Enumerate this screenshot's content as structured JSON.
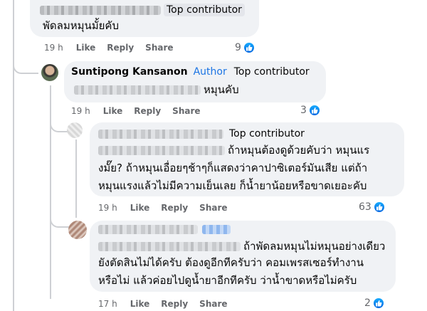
{
  "comments": [
    {
      "author_redacted": true,
      "badge": "Top contributor",
      "text_lines": [
        "พัดลมหมุนมั้ยคับ"
      ],
      "timestamp": "19 h",
      "actions": {
        "like": "Like",
        "reply": "Reply",
        "share": "Share"
      },
      "reaction_count": "9"
    },
    {
      "author": "Suntipong Kansanon",
      "author_label": "Author",
      "badge": "Top contributor",
      "text_suffix": "หมุนคับ",
      "timestamp": "19 h",
      "actions": {
        "like": "Like",
        "reply": "Reply",
        "share": "Share"
      },
      "reaction_count": "3"
    },
    {
      "author_redacted": true,
      "badge": "Top contributor",
      "text_first_line_suffix": "ถ้าหมุนต้องดูด้วยคับว่า หมุนแร",
      "text_lines": [
        "งมั๊ย? ถ้าหมุนเอื่อยๆช้าๆก็แสดงว่าคาปาซิเตอร์มันเสีย แต่ถ้า",
        "หมุนแรงแล้วไม่มีความเย็นเลย ก็น้ำยาน้อยหรือขาดเยอะคับ"
      ],
      "timestamp": "19 h",
      "actions": {
        "like": "Like",
        "reply": "Reply",
        "share": "Share"
      },
      "reaction_count": "63"
    },
    {
      "author_redacted": true,
      "text_first_line_suffix": "ถ้าพัดลมหมุนไม่หมุนอย่างเดียว",
      "text_lines": [
        "ยังตัดสินไม่ได้ครับ ต้องดูอีกทีครับว่า คอมเพรสเซอร์ทำงาน",
        "หรือไม่ แล้วค่อยไปดูน้ำยาอีกทีครับ ว่าน้ำขาดหรือไม่ครับ"
      ],
      "timestamp": "17 h",
      "actions": {
        "like": "Like",
        "reply": "Reply",
        "share": "Share"
      },
      "reaction_count": "2"
    }
  ],
  "colors": {
    "bubble": "#f0f2f5",
    "like_blue": "#0866ff",
    "meta": "#65676b",
    "author_blue": "#1b74e4"
  }
}
